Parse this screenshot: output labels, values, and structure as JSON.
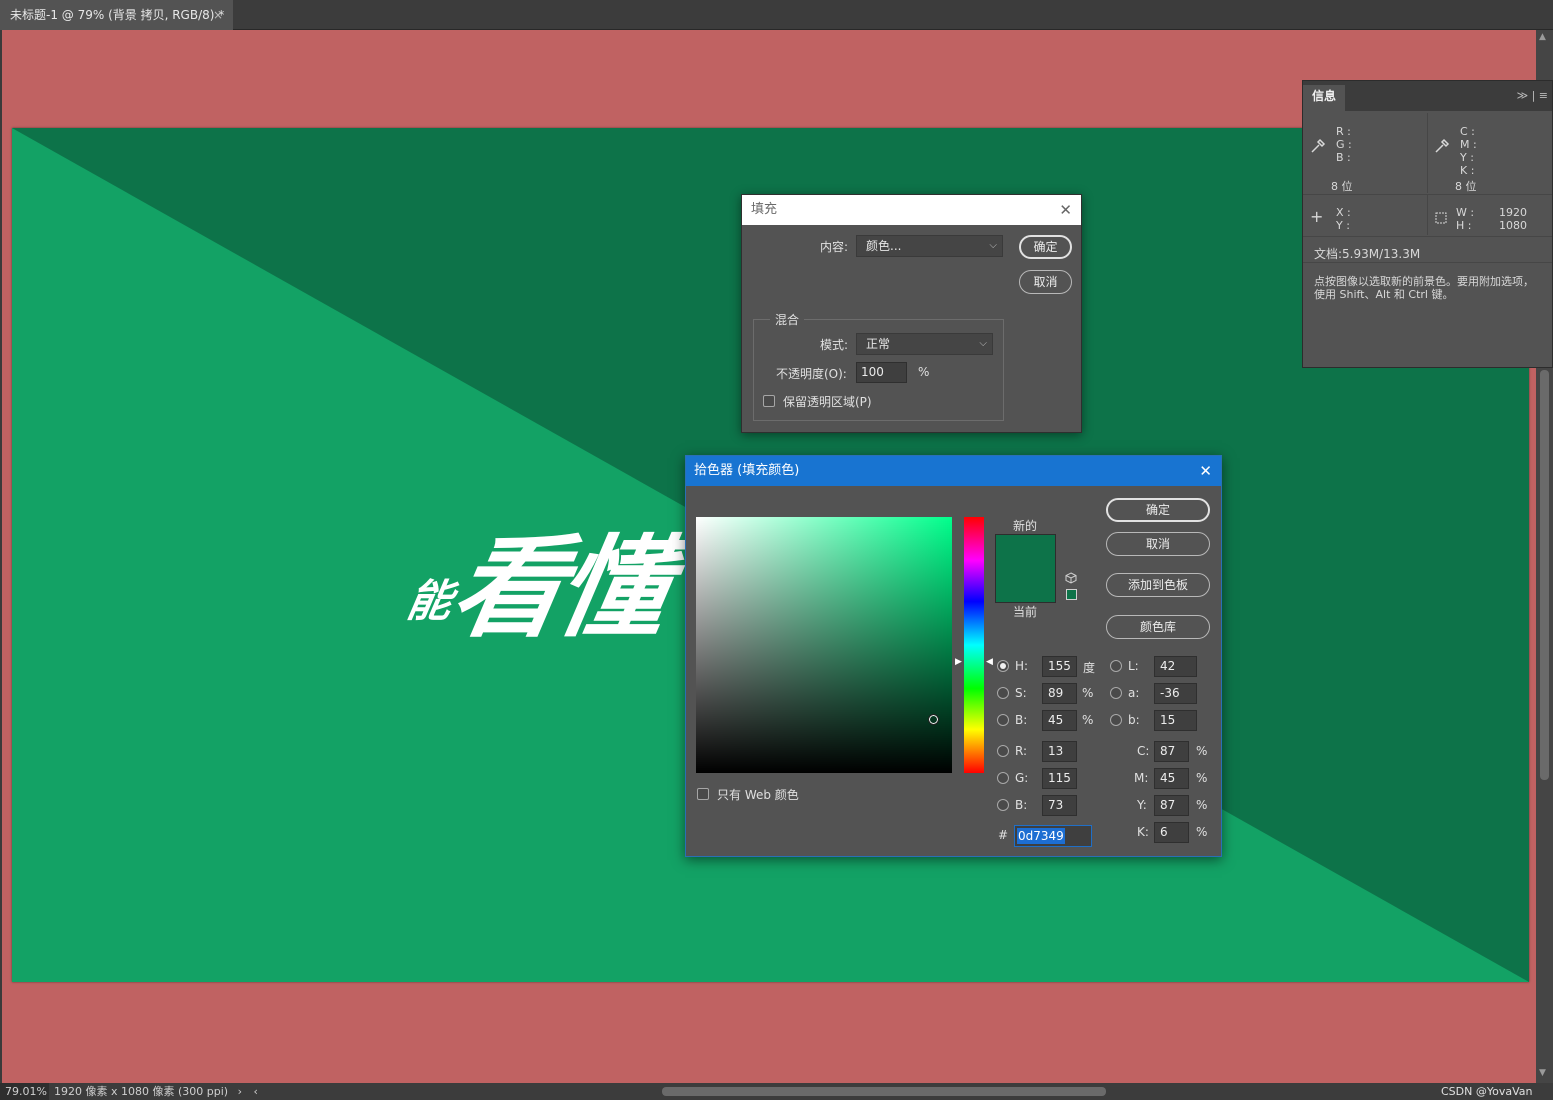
{
  "document": {
    "tab_title": "未标题-1 @ 79% (背景 拷贝, RGB/8) *",
    "tab_close": "×",
    "zoom": "79.01%",
    "size_info": "1920 像素 x 1080 像素 (300 ppi)",
    "nav_right": "›",
    "nav_left": "‹"
  },
  "canvas": {
    "headline_small": "能",
    "headline_big": "看懂",
    "bg_dark": "#0d7349",
    "bg_light": "#13a265",
    "pasteboard": "#c06262"
  },
  "watermark": "CSDN @YovaVan",
  "info_panel": {
    "tab": "信息",
    "menu": "≫ | ≡",
    "rgb_labels": "R :\nG :\nB :",
    "cmyk_labels": "C :\nM :\nY :\nK :",
    "bits_left": "8 位",
    "bits_right": "8 位",
    "xy_labels": "X :\nY :",
    "wh_labels": "W :\nH :",
    "w_value": "1920",
    "h_value": "1080",
    "doc": "文档:5.93M/13.3M",
    "hint": "点按图像以选取新的前景色。要用附加选项，使用 Shift、Alt 和 Ctrl 键。"
  },
  "fill_dialog": {
    "title": "填充",
    "close": "✕",
    "content_label": "内容:",
    "content_value": "颜色...",
    "ok": "确定",
    "cancel": "取消",
    "blend_group": "混合",
    "mode_label": "模式:",
    "mode_value": "正常",
    "opacity_label": "不透明度(O):",
    "opacity_value": "100",
    "opacity_unit": "%",
    "preserve_label": "保留透明区域(P)"
  },
  "picker_dialog": {
    "title": "拾色器 (填充颜色)",
    "close": "✕",
    "new_label": "新的",
    "current_label": "当前",
    "ok": "确定",
    "cancel": "取消",
    "add_swatch": "添加到色板",
    "color_lib": "颜色库",
    "web_only": "只有 Web 颜色",
    "new_color": "#0d7349",
    "current_color": "#0d7349",
    "hsb": {
      "H": "155",
      "S": "89",
      "B": "45",
      "h_unit": "度",
      "s_unit": "%",
      "b_unit": "%"
    },
    "lab": {
      "L": "42",
      "a": "-36",
      "b": "15"
    },
    "rgb": {
      "R": "13",
      "G": "115",
      "B": "73"
    },
    "cmyk": {
      "C": "87",
      "M": "45",
      "Y": "87",
      "K": "6",
      "unit": "%"
    },
    "hex_prefix": "#",
    "hex": "0d7349",
    "labels": {
      "H": "H:",
      "S": "S:",
      "B": "B:",
      "R": "R:",
      "G": "G:",
      "B2": "B:",
      "L": "L:",
      "a": "a:",
      "b": "b:",
      "C": "C:",
      "M": "M:",
      "Y": "Y:",
      "K": "K:"
    }
  }
}
